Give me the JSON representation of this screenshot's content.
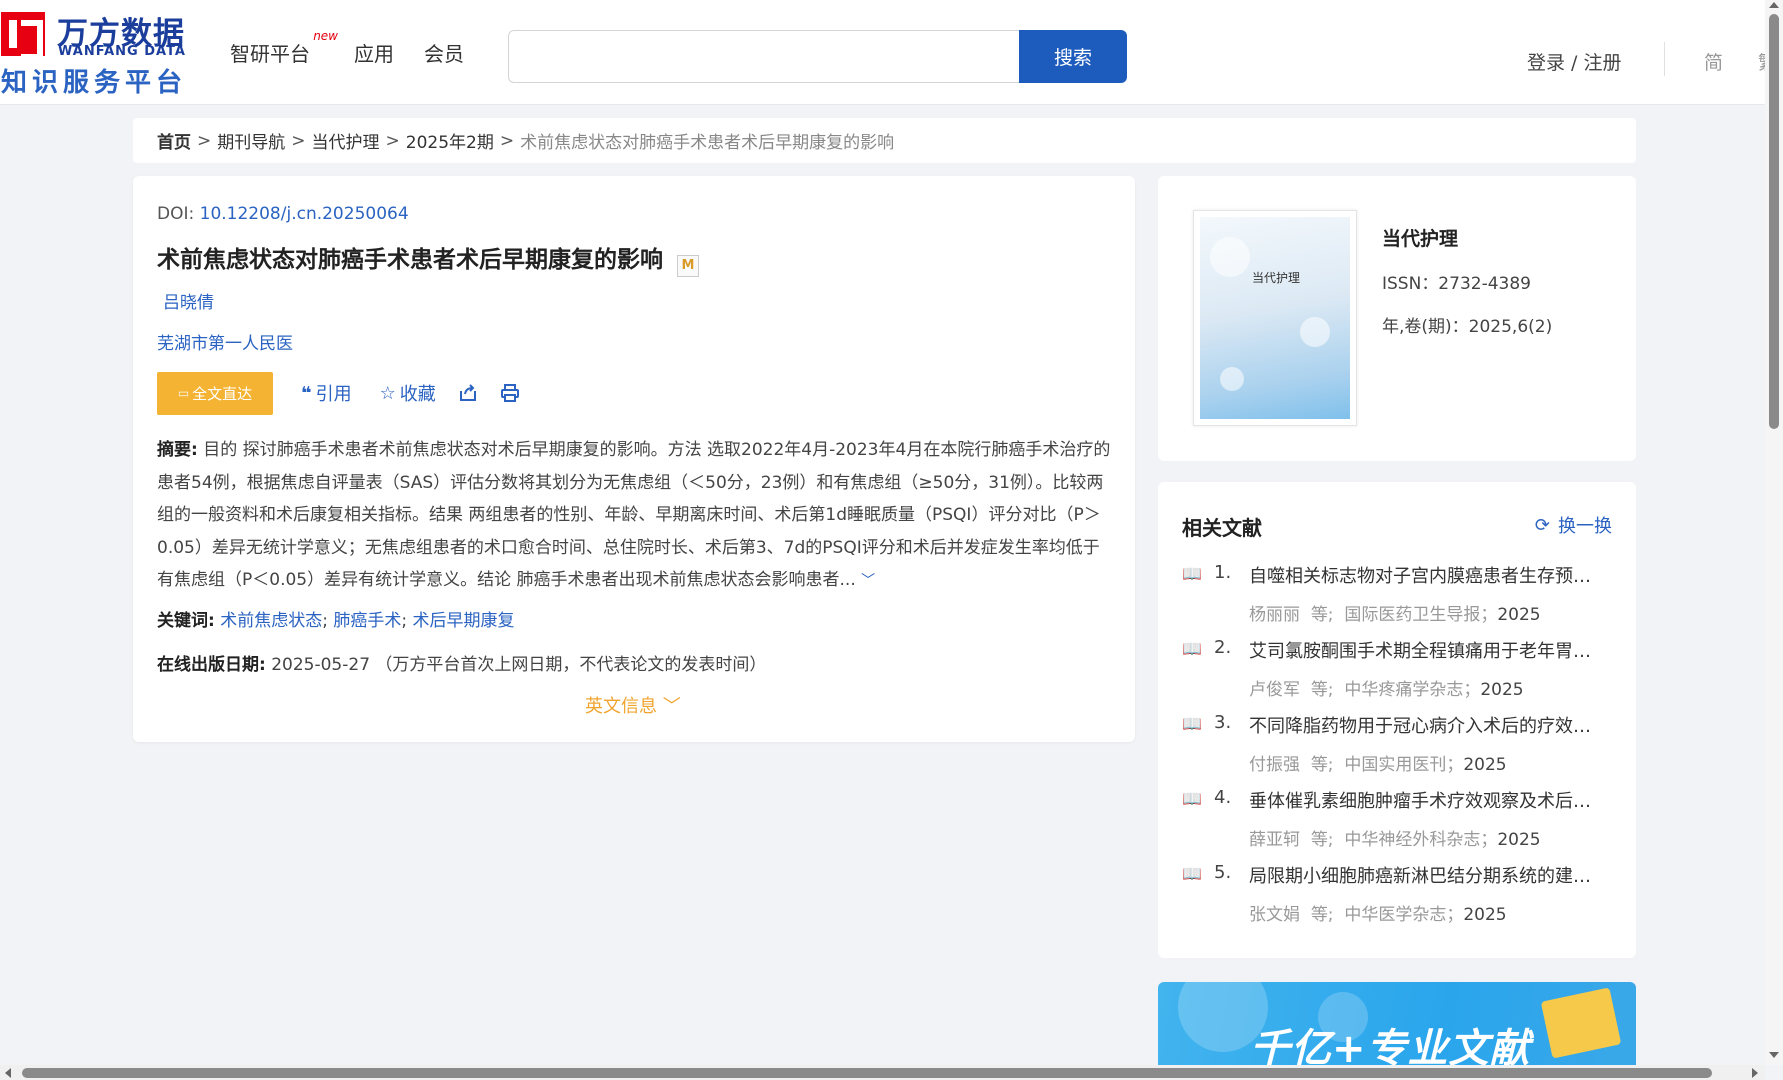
{
  "header": {
    "logo": {
      "cn": "万方数据",
      "en": "WANFANG DATA",
      "sub": "知识服务平台"
    },
    "nav": [
      {
        "label": "智研平台",
        "badge": "new"
      },
      {
        "label": "应用"
      },
      {
        "label": "会员"
      }
    ],
    "search": {
      "value": "",
      "placeholder": "",
      "button": "搜索"
    },
    "login": "登录 / 注册",
    "lang": [
      "简",
      "繁"
    ]
  },
  "breadcrumb": {
    "items": [
      "首页",
      "期刊导航",
      "当代护理",
      "2025年2期"
    ],
    "current": "术前焦虑状态对肺癌手术患者术后早期康复的影响",
    "separator": ">"
  },
  "article": {
    "doi_label": "DOI: ",
    "doi": "10.12208/j.cn.20250064",
    "title": "术前焦虑状态对肺癌手术患者术后早期康复的影响",
    "badge": "M",
    "author": "吕晓倩",
    "affiliation": "芜湖市第一人民医",
    "actions": {
      "full_text": "全文直达",
      "cite": "引用",
      "favorite": "收藏"
    },
    "abstract_label": "摘要:",
    "abstract": "目的 探讨肺癌手术患者术前焦虑状态对术后早期康复的影响。方法 选取2022年4月-2023年4月在本院行肺癌手术治疗的患者54例，根据焦虑自评量表（SAS）评估分数将其划分为无焦虑组（＜50分，23例）和有焦虑组（≥50分，31例）。比较两组的一般资料和术后康复相关指标。结果 两组患者的性别、年龄、早期离床时间、术后第1d睡眠质量（PSQI）评分对比（P＞0.05）差异无统计学意义；无焦虑组患者的术口愈合时间、总住院时长、术后第3、7d的PSQI评分和术后并发症发生率均低于有焦虑组（P＜0.05）差异有统计学意义。结论 肺癌手术患者出现术前焦虑状态会影响患者...",
    "keywords_label": "关键词:",
    "keywords": [
      "术前焦虑状态",
      "肺癌手术",
      "术后早期康复"
    ],
    "pubdate_label": "在线出版日期:",
    "pubdate": "2025-05-27",
    "pubdate_note": "（万方平台首次上网日期，不代表论文的发表时间）",
    "english_info": "英文信息"
  },
  "journal": {
    "name": "当代护理",
    "cover_title": "当代护理",
    "issn": "ISSN：2732-4389",
    "volume": "年,卷(期)：2025,6(2)"
  },
  "related": {
    "title": "相关文献",
    "refresh": "换一换",
    "items": [
      {
        "num": "1.",
        "title": "自噬相关标志物对子宫内膜癌患者生存预后的影响",
        "authors": "杨丽丽",
        "etal": "等;",
        "source": "国际医药卫生导报；",
        "year": "2025"
      },
      {
        "num": "2.",
        "title": "艾司氯胺酮围手术期全程镇痛用于老年胃肠道手术",
        "authors": "卢俊军",
        "etal": "等;",
        "source": "中华疼痛学杂志；",
        "year": "2025"
      },
      {
        "num": "3.",
        "title": "不同降脂药物用于冠心病介入术后的疗效及安全性",
        "authors": "付振强",
        "etal": "等;",
        "source": "中国实用医刊；",
        "year": "2025"
      },
      {
        "num": "4.",
        "title": "垂体催乳素细胞肿瘤手术疗效观察及术后生化缓解",
        "authors": "薛亚轲",
        "etal": "等;",
        "source": "中华神经外科杂志；",
        "year": "2025"
      },
      {
        "num": "5.",
        "title": "局限期小细胞肺癌新淋巴结分期系统的建立及验证",
        "authors": "张文娟",
        "etal": "等;",
        "source": "中华医学杂志；",
        "year": "2025"
      }
    ]
  },
  "banner": {
    "text": "千亿+专业文献"
  },
  "colors": {
    "brand_blue": "#1d5cbd",
    "link": "#2b63c2",
    "accent_orange": "#f4b333",
    "logo_red": "#e60012"
  }
}
